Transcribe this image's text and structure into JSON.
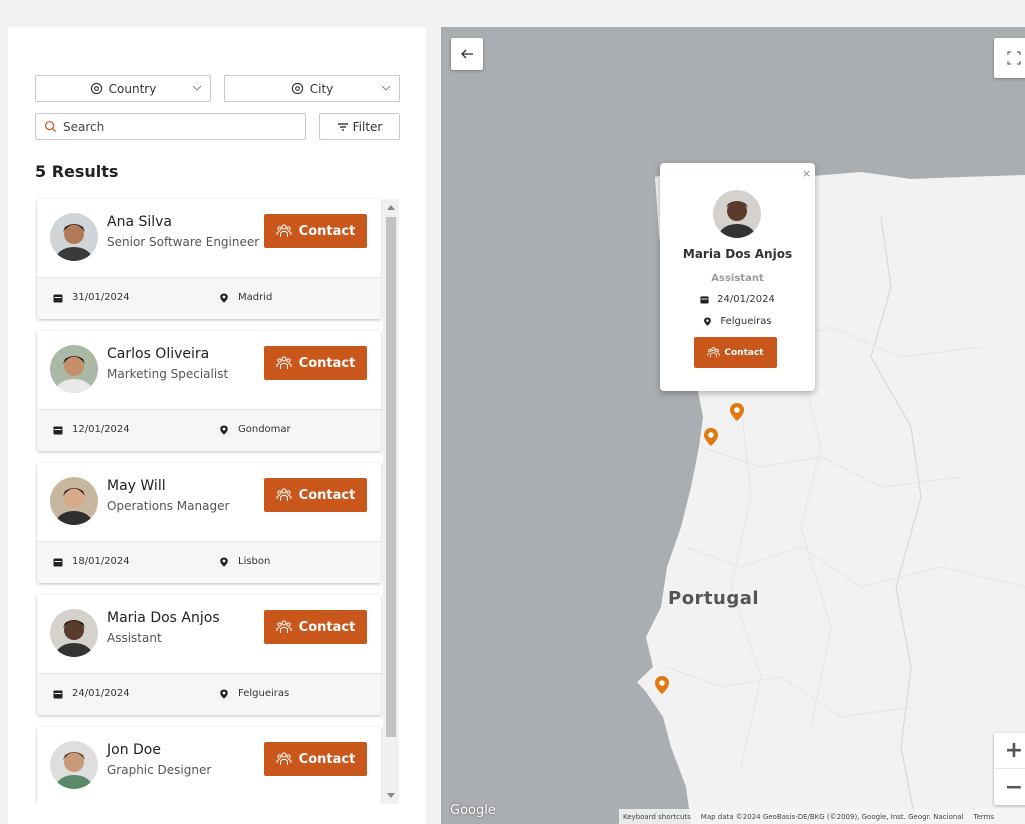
{
  "filters": {
    "country_label": "Country",
    "city_label": "City",
    "search_placeholder": "Search",
    "filter_label": "Filter"
  },
  "results_title": "5 Results",
  "contact_label": "Contact",
  "people": [
    {
      "name": "Ana Silva",
      "role": "Senior Software Engineer",
      "date": "31/01/2024",
      "city": "Madrid"
    },
    {
      "name": "Carlos Oliveira",
      "role": "Marketing Specialist",
      "date": "12/01/2024",
      "city": "Gondomar"
    },
    {
      "name": "May Will",
      "role": "Operations Manager",
      "date": "18/01/2024",
      "city": "Lisbon"
    },
    {
      "name": "Maria Dos Anjos",
      "role": "Assistant",
      "date": "24/01/2024",
      "city": "Felgueiras"
    },
    {
      "name": "Jon Doe",
      "role": "Graphic Designer",
      "date": "",
      "city": ""
    }
  ],
  "map": {
    "country_label": "Portugal",
    "google_label": "Google",
    "attribution": [
      "Keyboard shortcuts",
      "Map data ©2024 GeoBasis-DE/BKG (©2009), Google, Inst. Geogr. Nacional",
      "Terms"
    ],
    "zoom_in": "+",
    "zoom_out": "−",
    "popup": {
      "close": "×",
      "name": "Maria Dos Anjos",
      "role": "Assistant",
      "date": "24/01/2024",
      "city": "Felgueiras",
      "contact": "Contact"
    }
  },
  "colors": {
    "accent": "#c9561a",
    "marker": "#e07a10",
    "sea": "#aaadb1",
    "land": "#f2f2f2"
  }
}
